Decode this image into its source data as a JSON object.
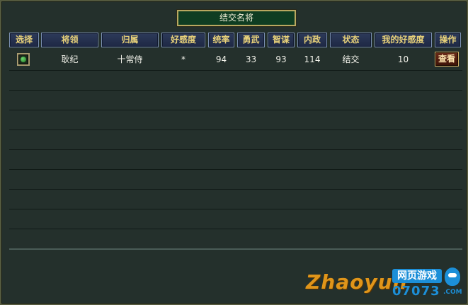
{
  "dialog": {
    "title": "结交名将"
  },
  "columns": [
    {
      "key": "select",
      "label": "选择"
    },
    {
      "key": "general",
      "label": "将领"
    },
    {
      "key": "faction",
      "label": "归属"
    },
    {
      "key": "favor",
      "label": "好感度"
    },
    {
      "key": "command",
      "label": "统率"
    },
    {
      "key": "valor",
      "label": "勇武"
    },
    {
      "key": "intellect",
      "label": "智谋"
    },
    {
      "key": "politics",
      "label": "内政"
    },
    {
      "key": "status",
      "label": "状态"
    },
    {
      "key": "my_favor",
      "label": "我的好感度"
    },
    {
      "key": "action",
      "label": "操作"
    }
  ],
  "rows": [
    {
      "general": "耿纪",
      "faction": "十常侍",
      "favor": "*",
      "command": "94",
      "valor": "33",
      "intellect": "93",
      "politics": "114",
      "status": "结交",
      "my_favor": "10",
      "action_label": "查看"
    }
  ],
  "watermark": {
    "brand": "Zhaoyun",
    "site_cn": "网页游戏",
    "site_num": "07073",
    "site_tld": ".COM"
  }
}
